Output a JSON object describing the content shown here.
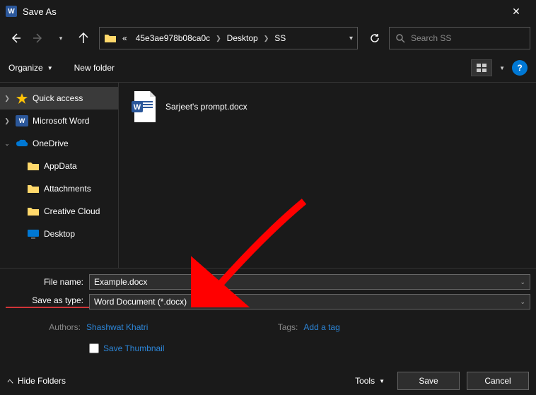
{
  "window": {
    "title": "Save As"
  },
  "nav": {
    "breadcrumb_prefix": "«",
    "crumbs": [
      "45e3ae978b08ca0c",
      "Desktop",
      "SS"
    ]
  },
  "search": {
    "placeholder": "Search SS"
  },
  "toolbar": {
    "organize": "Organize",
    "newfolder": "New folder"
  },
  "sidebar": {
    "quick": "Quick access",
    "word": "Microsoft Word",
    "onedrive": "OneDrive",
    "appdata": "AppData",
    "attachments": "Attachments",
    "creative": "Creative Cloud",
    "desktop": "Desktop"
  },
  "file": {
    "name": "Sarjeet's prompt.docx"
  },
  "form": {
    "filename_label": "File name:",
    "filename_value": "Example.docx",
    "type_label": "Save as type:",
    "type_value": "Word Document (*.docx)"
  },
  "meta": {
    "authors_label": "Authors:",
    "authors_value": "Shashwat Khatri",
    "tags_label": "Tags:",
    "tags_value": "Add a tag"
  },
  "thumb": {
    "label": "Save Thumbnail"
  },
  "footer": {
    "hide": "Hide Folders",
    "tools": "Tools",
    "save": "Save",
    "cancel": "Cancel"
  }
}
